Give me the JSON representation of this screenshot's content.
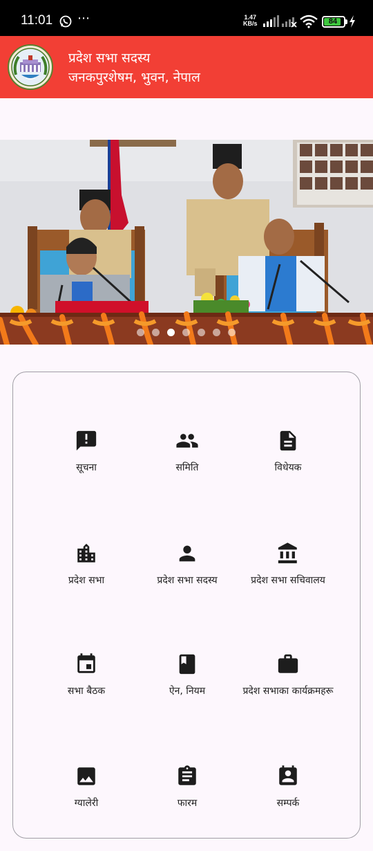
{
  "status_bar": {
    "time": "11:01",
    "dots": "⋯",
    "net_speed_value": "1.47",
    "net_speed_unit": "KB/s",
    "battery": "84"
  },
  "app_bar": {
    "title_line1": "प्रदेश सभा सदस्य",
    "title_line2": "जनकपुरशेषम, भुवन, नेपाल",
    "color": "#f23f35"
  },
  "carousel": {
    "slide_count": 7,
    "active_index": 2
  },
  "menu": {
    "items": [
      {
        "label": "सूचना",
        "icon": "announcement-icon"
      },
      {
        "label": "समिति",
        "icon": "people-icon"
      },
      {
        "label": "विधेयक",
        "icon": "document-icon"
      },
      {
        "label": "प्रदेश सभा",
        "icon": "building-icon"
      },
      {
        "label": "प्रदेश सभा सदस्य",
        "icon": "person-icon"
      },
      {
        "label": "प्रदेश सभा सचिवालय",
        "icon": "institution-icon"
      },
      {
        "label": "सभा बैठक",
        "icon": "calendar-icon"
      },
      {
        "label": "ऐन, नियम",
        "icon": "book-icon"
      },
      {
        "label": "प्रदेश सभाका कार्यक्रमहरू",
        "icon": "briefcase-icon"
      },
      {
        "label": "ग्यालेरी",
        "icon": "image-icon"
      },
      {
        "label": "फारम",
        "icon": "clipboard-icon"
      },
      {
        "label": "सम्पर्क",
        "icon": "contact-card-icon"
      }
    ]
  }
}
